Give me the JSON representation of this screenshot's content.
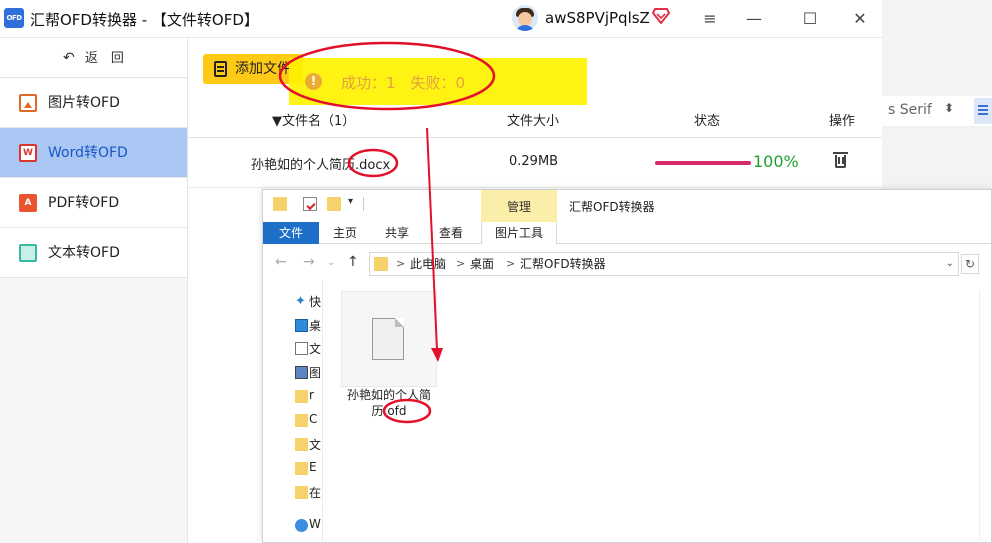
{
  "app": {
    "logo_text": "OFD",
    "title": "汇帮OFD转换器 - 【文件转OFD】",
    "username": "awS8PVjPqlsZ",
    "window_controls": {
      "menu": "≡",
      "minimize": "—",
      "maximize": "☐",
      "close": "✕"
    }
  },
  "sidebar": {
    "back_arrow": "↶",
    "back_label": "返　回",
    "items": [
      {
        "label": "图片转OFD",
        "icon": "image-icon"
      },
      {
        "label": "Word转OFD",
        "icon": "word-icon",
        "icon_text": "W",
        "active": true
      },
      {
        "label": "PDF转OFD",
        "icon": "pdf-icon",
        "icon_text": "A"
      },
      {
        "label": "文本转OFD",
        "icon": "text-icon"
      }
    ]
  },
  "toolbar": {
    "add_file": "添加文件"
  },
  "toast": {
    "icon": "!",
    "message": "成功：1　失败：0"
  },
  "table": {
    "columns": {
      "name": "▼文件名（1）",
      "size": "文件大小",
      "status": "状态",
      "action": "操作"
    },
    "rows": [
      {
        "name": "孙艳如的个人简历.docx",
        "size": "0.29MB",
        "progress": 1.0,
        "progress_text": "100%"
      }
    ]
  },
  "background_window": {
    "font_name": "s Serif",
    "updown": "⬍"
  },
  "explorer": {
    "title": "汇帮OFD转换器",
    "manage_tab": "管理",
    "ribbon_tabs": [
      "文件",
      "主页",
      "共享",
      "查看"
    ],
    "picture_tools": "图片工具",
    "address": {
      "crumbs": [
        "此电脑",
        "桌面",
        "汇帮OFD转换器"
      ],
      "separator": ">"
    },
    "nav_items": [
      {
        "label": "快",
        "icon": "star-icon"
      },
      {
        "label": "桌",
        "icon": "desktop-icon"
      },
      {
        "label": "文",
        "icon": "documents-icon"
      },
      {
        "label": "图",
        "icon": "pictures-icon"
      },
      {
        "label": "r",
        "icon": "folder-icon"
      },
      {
        "label": "C",
        "icon": "folder-icon"
      },
      {
        "label": "文",
        "icon": "folder-icon"
      },
      {
        "label": "E",
        "icon": "folder-icon"
      },
      {
        "label": "在",
        "icon": "folder-icon"
      },
      {
        "label": "W",
        "icon": "onedrive-icon"
      }
    ],
    "file": {
      "name": "孙艳如的个人简历.ofd"
    }
  },
  "colors": {
    "accent": "#1e6fc8",
    "sidebar_active": "#a9c7f2",
    "add_button": "#ffca16",
    "toast_bg": "#fff200",
    "progress": "#d42a6a",
    "success": "#1f9e2f",
    "annotation": "#e3102a"
  }
}
